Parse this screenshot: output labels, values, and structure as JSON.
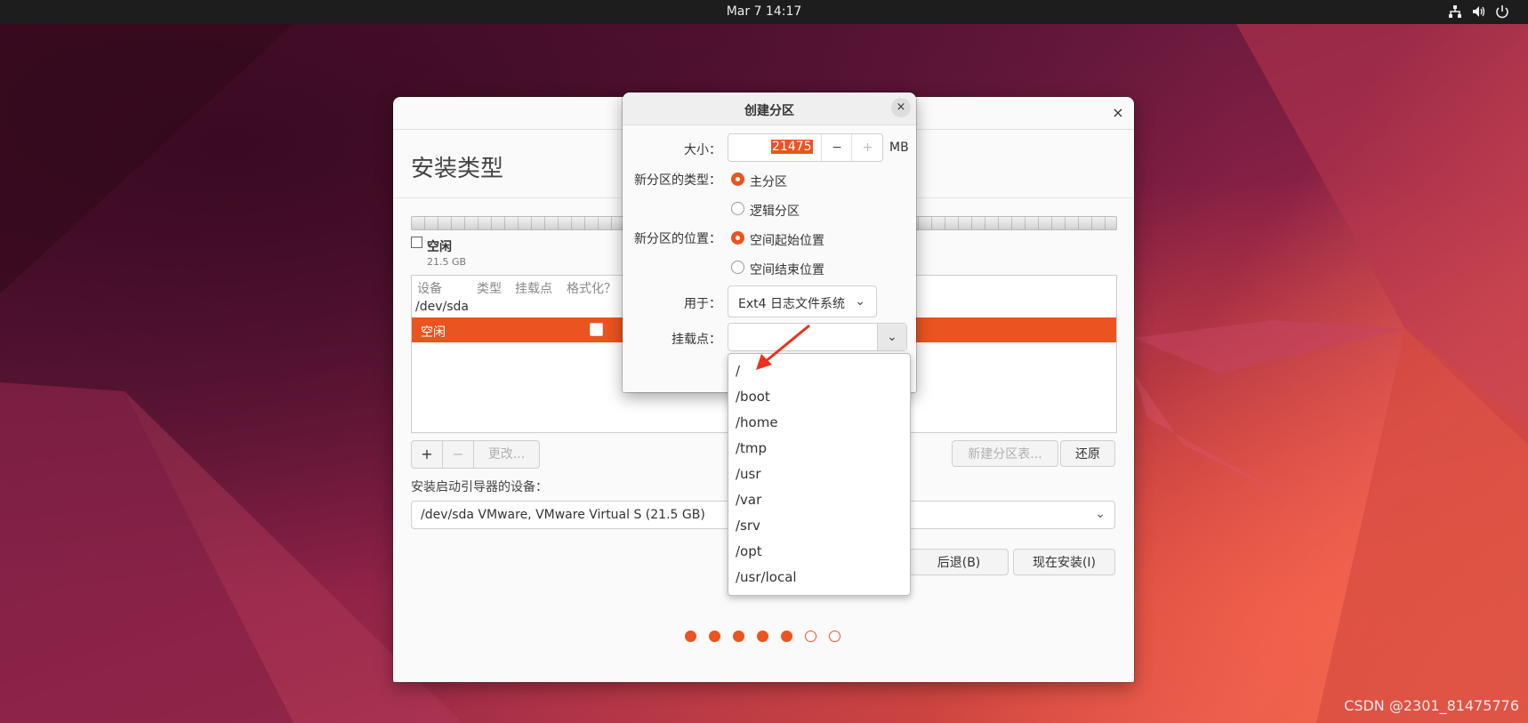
{
  "topbar": {
    "clock": "Mar 7  14:17",
    "icons": [
      "network-icon",
      "volume-icon",
      "power-icon"
    ]
  },
  "installer": {
    "close_symbol": "×",
    "title": "安装类型",
    "legend": {
      "label": "空闲",
      "size": "21.5 GB"
    },
    "table": {
      "headers": [
        "设备",
        "类型",
        "挂载点",
        "格式化？"
      ],
      "device": "/dev/sda",
      "selected_row_label": "空闲"
    },
    "buttons": {
      "add": "+",
      "remove": "−",
      "change": "更改...",
      "new_table": "新建分区表...",
      "revert": "还原",
      "back": "后退(B)",
      "install_now": "现在安装(I)"
    },
    "bootloader": {
      "label": "安装启动引导器的设备：",
      "value": "/dev/sda VMware, VMware Virtual S (21.5 GB)"
    },
    "progress": {
      "total_steps": 7,
      "completed_steps": 5
    }
  },
  "dialog": {
    "title": "创建分区",
    "close_symbol": "×",
    "size": {
      "label": "大小：",
      "value": "21475",
      "minus": "−",
      "plus": "+",
      "unit": "MB"
    },
    "type": {
      "label": "新分区的类型：",
      "options": [
        "主分区",
        "逻辑分区"
      ],
      "selected": "主分区"
    },
    "location": {
      "label": "新分区的位置：",
      "options": [
        "空间起始位置",
        "空间结束位置"
      ],
      "selected": "空间起始位置"
    },
    "use_as": {
      "label": "用于：",
      "value": "Ext4 日志文件系统"
    },
    "mount": {
      "label": "挂载点：",
      "value": "",
      "options": [
        "/",
        "/boot",
        "/home",
        "/tmp",
        "/usr",
        "/var",
        "/srv",
        "/opt",
        "/usr/local"
      ]
    }
  },
  "colors": {
    "accent": "#e95420",
    "topbar": "#1d1d1d",
    "annotation_arrow": "#e8321e"
  },
  "watermark": "CSDN @2301_81475776"
}
